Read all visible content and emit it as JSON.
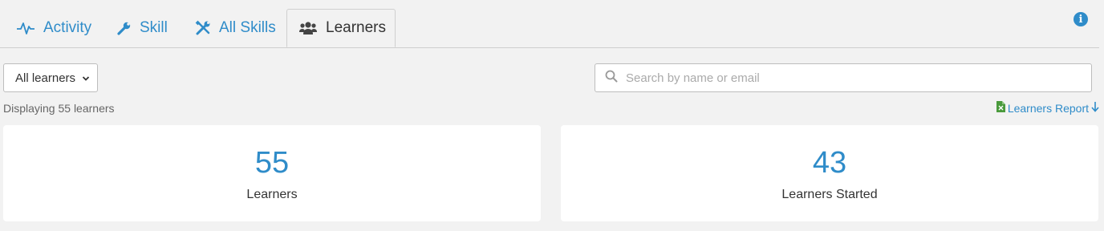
{
  "tabs": [
    {
      "label": "Activity",
      "icon": "pulse-icon"
    },
    {
      "label": "Skill",
      "icon": "wrench-icon"
    },
    {
      "label": "All Skills",
      "icon": "tools-icon"
    },
    {
      "label": "Learners",
      "icon": "users-icon",
      "active": true
    }
  ],
  "info_icon": "info-icon",
  "filter": {
    "selected": "All learners",
    "icon": "chevron-down-icon"
  },
  "search": {
    "placeholder": "Search by name or email",
    "value": "",
    "icon": "search-icon"
  },
  "display_count": "Displaying 55 learners",
  "report": {
    "label": "Learners Report",
    "file_icon": "excel-file-icon",
    "download_icon": "arrow-down-icon"
  },
  "stats": [
    {
      "value": "55",
      "label": "Learners"
    },
    {
      "value": "43",
      "label": "Learners Started"
    }
  ],
  "colors": {
    "accent": "#2f8cc9",
    "background": "#f2f2f2",
    "excel": "#4a9a3c"
  }
}
